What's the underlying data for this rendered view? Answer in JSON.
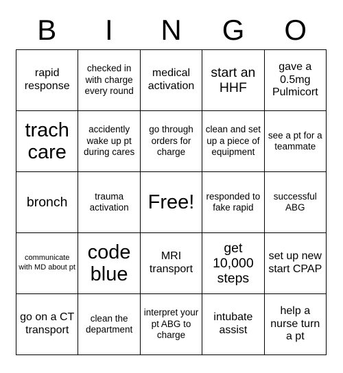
{
  "header": {
    "letters": [
      "B",
      "I",
      "N",
      "G",
      "O"
    ]
  },
  "grid": {
    "rows": 5,
    "columns": 5,
    "border_color": "#000000",
    "background_color": "#ffffff",
    "text_color": "#000000",
    "cells": [
      {
        "text": "rapid response",
        "size": "md"
      },
      {
        "text": "checked in with charge every round",
        "size": "sm"
      },
      {
        "text": "medical activation",
        "size": "md"
      },
      {
        "text": "start an HHF",
        "size": "lg"
      },
      {
        "text": "gave a 0.5mg Pulmicort",
        "size": "md"
      },
      {
        "text": "trach care",
        "size": "xl"
      },
      {
        "text": "accidently wake up pt during cares",
        "size": "sm"
      },
      {
        "text": "go through orders for charge",
        "size": "sm"
      },
      {
        "text": "clean and set up a piece of equipment",
        "size": "sm"
      },
      {
        "text": "see a pt for a teammate",
        "size": "sm"
      },
      {
        "text": "bronch",
        "size": "lg"
      },
      {
        "text": "trauma activation",
        "size": "sm"
      },
      {
        "text": "Free!",
        "size": "xl"
      },
      {
        "text": "responded to fake rapid",
        "size": "sm"
      },
      {
        "text": "successful ABG",
        "size": "sm"
      },
      {
        "text": "communicate with MD about pt",
        "size": "xs"
      },
      {
        "text": "code blue",
        "size": "xl"
      },
      {
        "text": "MRI transport",
        "size": "md"
      },
      {
        "text": "get 10,000 steps",
        "size": "lg"
      },
      {
        "text": "set up new start CPAP",
        "size": "md"
      },
      {
        "text": "go on a CT transport",
        "size": "md"
      },
      {
        "text": "clean the department",
        "size": "sm"
      },
      {
        "text": "interpret your pt ABG to charge",
        "size": "sm"
      },
      {
        "text": "intubate assist",
        "size": "md"
      },
      {
        "text": "help a nurse turn a pt",
        "size": "md"
      }
    ]
  }
}
